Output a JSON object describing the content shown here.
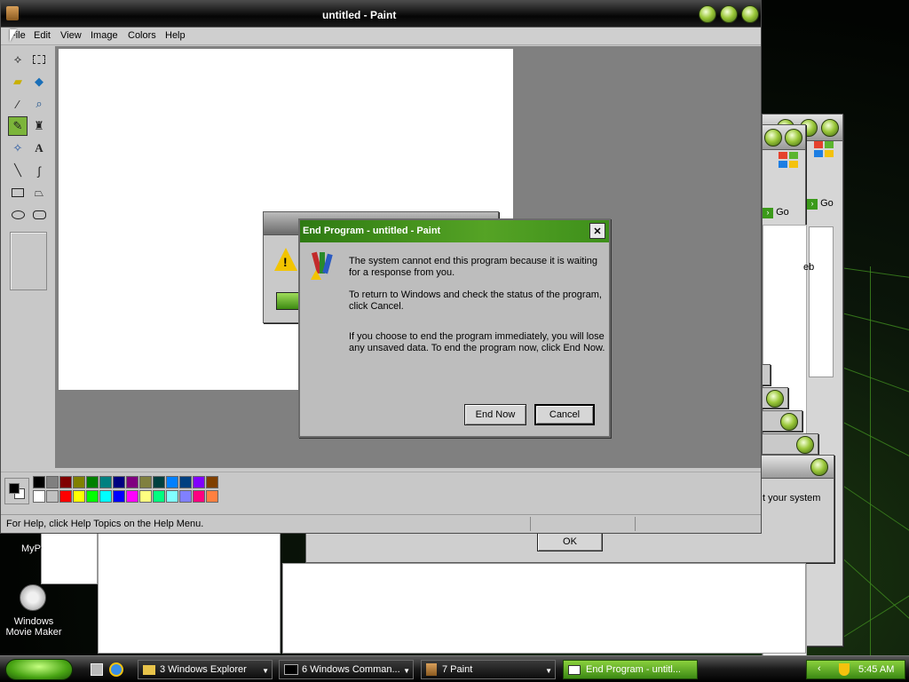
{
  "paint": {
    "title": "untitled - Paint",
    "menu": [
      "File",
      "Edit",
      "View",
      "Image",
      "Colors",
      "Help"
    ],
    "tools": [
      "free-select",
      "rect-select",
      "eraser",
      "fill",
      "picker",
      "magnifier",
      "pencil",
      "brush",
      "airbrush",
      "text",
      "line",
      "curve",
      "rectangle",
      "polygon",
      "ellipse",
      "rounded-rectangle"
    ],
    "selected_tool": "pencil",
    "palette_top": [
      "#000000",
      "#808080",
      "#800000",
      "#808000",
      "#008000",
      "#008080",
      "#000080",
      "#800080",
      "#808040",
      "#004040",
      "#0080ff",
      "#004080",
      "#8000ff",
      "#804000"
    ],
    "palette_bottom": [
      "#ffffff",
      "#c0c0c0",
      "#ff0000",
      "#ffff00",
      "#00ff00",
      "#00ffff",
      "#0000ff",
      "#ff00ff",
      "#ffff80",
      "#00ff80",
      "#80ffff",
      "#8080ff",
      "#ff0080",
      "#ff8040"
    ],
    "status_text": "For Help, click Help Topics on the Help Menu."
  },
  "dialog": {
    "title": "End Program - untitled - Paint",
    "close_glyph": "✕",
    "para1": "The system cannot end this program because it is waiting for a response from you.",
    "para2": "To return to Windows and check the status of the program, click Cancel.",
    "para3": "If you choose to end the program immediately, you will lose any unsaved data. To end the program now, click End Now.",
    "end_now_label": "End Now",
    "cancel_label": "Cancel"
  },
  "background": {
    "go_label": "Go",
    "system_text": "t your system",
    "ok_label": "OK",
    "partial_text_b": "eb",
    "partial_text_mp": "MyP",
    "warning_glyph": "!"
  },
  "desktop": {
    "movie_maker_label": "Windows Movie Maker"
  },
  "taskbar": {
    "buttons": [
      {
        "label": "3 Windows Explorer",
        "icon": "folder-icon"
      },
      {
        "label": "6 Windows Comman...",
        "icon": "console-icon"
      },
      {
        "label": "7 Paint",
        "icon": "paint-icon"
      },
      {
        "label": "End Program - untitl...",
        "icon": "window-icon"
      }
    ],
    "clock": "5:45 AM"
  }
}
